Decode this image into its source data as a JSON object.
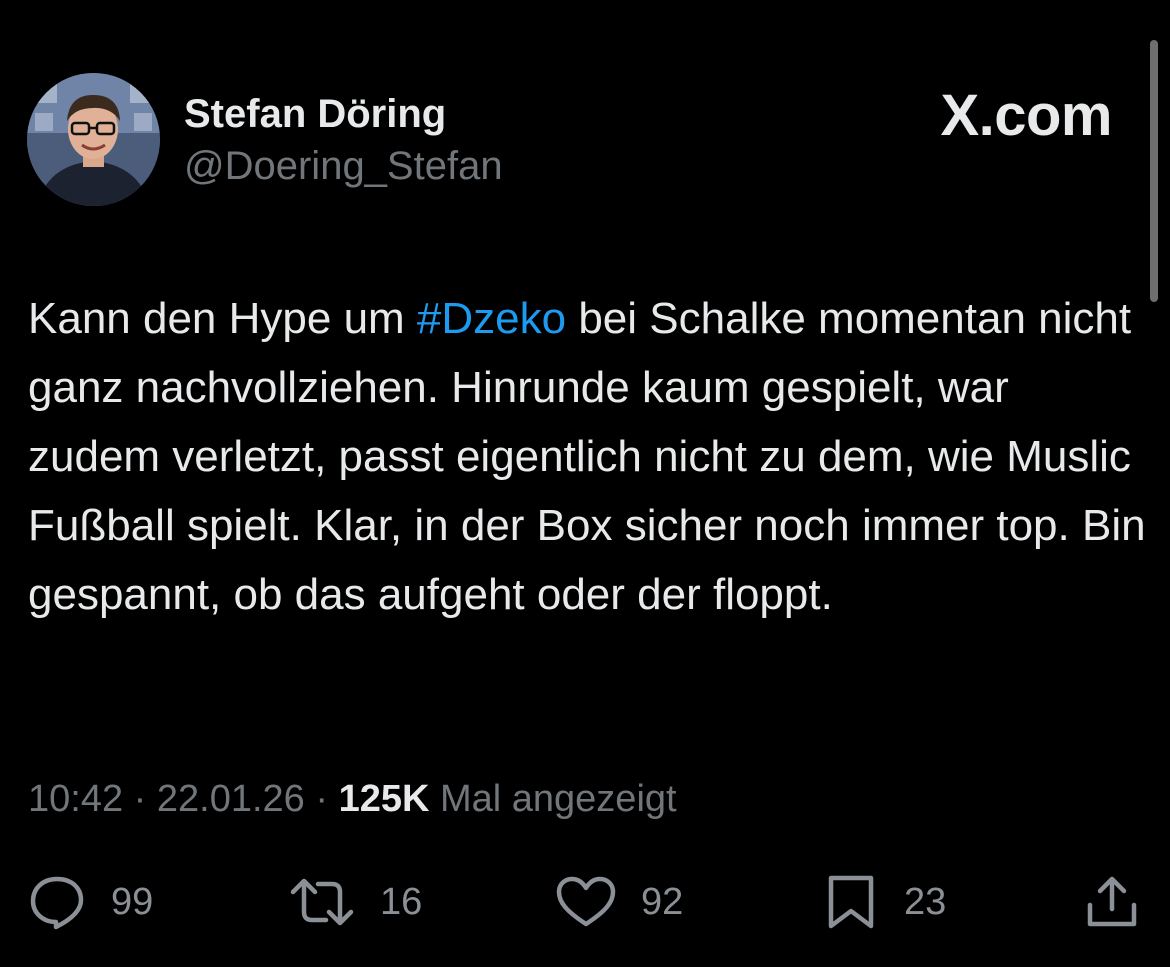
{
  "header": {
    "display_name": "Stefan Döring",
    "handle": "@Doering_Stefan",
    "brand": "X.com"
  },
  "tweet": {
    "text_before": "Kann den Hype um ",
    "hashtag": "#Dzeko",
    "text_after": " bei Schalke momentan nicht ganz nachvollziehen. Hinrunde kaum gespielt, war zudem verletzt, passt eigentlich nicht zu dem, wie Muslic Fußball spielt. Klar, in der Box sicher noch immer top. Bin gespannt, ob das aufgeht oder der floppt.",
    "time": "10:42",
    "separator": "·",
    "date": "22.01.26",
    "views_count": "125K",
    "views_label": "Mal angezeigt"
  },
  "actions": {
    "replies": "99",
    "reposts": "16",
    "likes": "92",
    "bookmarks": "23"
  },
  "colors": {
    "background": "#000000",
    "text": "#e7e9ea",
    "muted": "#71767b",
    "hashtag": "#1d9bf0"
  },
  "icons": [
    "reply-icon",
    "repost-icon",
    "like-icon",
    "bookmark-icon",
    "share-icon"
  ]
}
